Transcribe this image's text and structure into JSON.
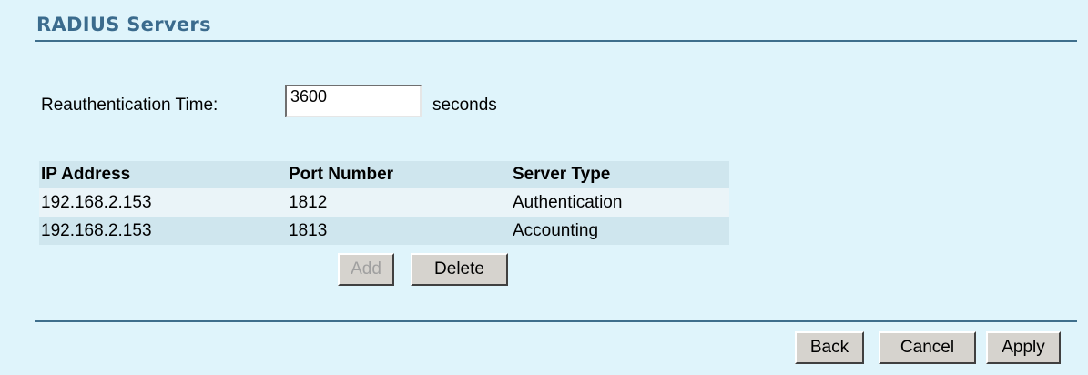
{
  "section": {
    "title": "RADIUS Servers"
  },
  "reauth": {
    "label": "Reauthentication Time:",
    "value": "3600",
    "unit": "seconds"
  },
  "servers": {
    "headers": [
      "IP Address",
      "Port Number",
      "Server Type"
    ],
    "rows": [
      [
        "192.168.2.153",
        "1812",
        "Authentication"
      ],
      [
        "192.168.2.153",
        "1813",
        "Accounting"
      ]
    ]
  },
  "table_actions": {
    "add_label": "Add",
    "delete_label": "Delete"
  },
  "footer": {
    "back_label": "Back",
    "cancel_label": "Cancel",
    "apply_label": "Apply"
  },
  "colors": {
    "background": "#dff4fb",
    "title": "#3b6b8d",
    "rule": "#3f6f8c",
    "row_dark": "#cfe6ee",
    "row_light": "#eaf4f8",
    "button": "#d6d3ce",
    "disabled_text": "#a0a0a0"
  }
}
